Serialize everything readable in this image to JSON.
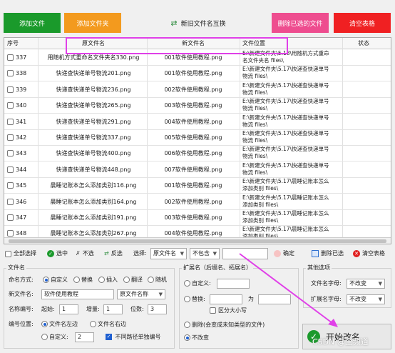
{
  "toolbar": {
    "add_files": "添加文件",
    "add_folder": "添加文件夹",
    "swap_names": "新旧文件名互换",
    "delete_checked": "删除已选的文件",
    "clear_table": "清空表格"
  },
  "table": {
    "headers": [
      "序号",
      "原文件名",
      "新文件名",
      "文件位置",
      "状态"
    ],
    "rows": [
      {
        "no": "337",
        "orig": "用随机方式重命名文件夹名330.png",
        "new": "001软件使用教程.png",
        "loc1": "E:\\新建文件夹\\5.18\\用随机方式重命",
        "loc2": "名文件夹名 files\\"
      },
      {
        "no": "338",
        "orig": "快递查快递单号物流201.png",
        "new": "001软件使用教程.png",
        "loc1": "E:\\新建文件夹\\5.17\\快递查快递单号",
        "loc2": "物流 files\\"
      },
      {
        "no": "339",
        "orig": "快递查快递单号物流236.png",
        "new": "002软件使用教程.png",
        "loc1": "E:\\新建文件夹\\5.17\\快递查快递单号",
        "loc2": "物流 files\\"
      },
      {
        "no": "340",
        "orig": "快递查快递单号物流265.png",
        "new": "003软件使用教程.png",
        "loc1": "E:\\新建文件夹\\5.17\\快递查快递单号",
        "loc2": "物流 files\\"
      },
      {
        "no": "341",
        "orig": "快递查快递单号物流291.png",
        "new": "004软件使用教程.png",
        "loc1": "E:\\新建文件夹\\5.17\\快递查快递单号",
        "loc2": "物流 files\\"
      },
      {
        "no": "342",
        "orig": "快递查快递单号物流337.png",
        "new": "005软件使用教程.png",
        "loc1": "E:\\新建文件夹\\5.17\\快递查快递单号",
        "loc2": "物流 files\\"
      },
      {
        "no": "343",
        "orig": "快递查快递单号物流400.png",
        "new": "006软件使用教程.png",
        "loc1": "E:\\新建文件夹\\5.17\\快递查快递单号",
        "loc2": "物流 files\\"
      },
      {
        "no": "344",
        "orig": "快递查快递单号物流448.png",
        "new": "007软件使用教程.png",
        "loc1": "E:\\新建文件夹\\5.17\\快递查快递单号",
        "loc2": "物流 files\\"
      },
      {
        "no": "345",
        "orig": "晨睡记账本怎么添加类别116.png",
        "new": "001软件使用教程.png",
        "loc1": "E:\\新建文件夹\\5.17\\晨睡记账本怎么",
        "loc2": "添加类别 files\\"
      },
      {
        "no": "346",
        "orig": "晨睡记账本怎么添加类别164.png",
        "new": "002软件使用教程.png",
        "loc1": "E:\\新建文件夹\\5.17\\晨睡记账本怎么",
        "loc2": "添加类别 files\\"
      },
      {
        "no": "347",
        "orig": "晨睡记账本怎么添加类别191.png",
        "new": "003软件使用教程.png",
        "loc1": "E:\\新建文件夹\\5.17\\晨睡记账本怎么",
        "loc2": "添加类别 files\\"
      },
      {
        "no": "348",
        "orig": "晨睡记账本怎么添加类别267.png",
        "new": "004软件使用教程.png",
        "loc1": "E:\\新建文件夹\\5.17\\晨睡记账本怎么",
        "loc2": "添加类别 files\\"
      }
    ]
  },
  "filter": {
    "select_all": "全部选择",
    "select": "选中",
    "deselect": "不选",
    "invert": "反选",
    "choose": "选择:",
    "field_value": "原文件名",
    "mode_value": "不包含",
    "text_value": "",
    "confirm": "确定",
    "delete_selected": "删除已选",
    "clear_table": "清空表格"
  },
  "filename": {
    "title": "文件名",
    "naming_mode_label": "命名方式:",
    "modes": [
      "自定义",
      "替换",
      "插入",
      "翻译",
      "随机"
    ],
    "new_name_label": "新文件名:",
    "new_name_value": "软件使用教程",
    "orig_name_option": "原文件名称",
    "numbering_label": "名称编号:",
    "start_label": "起始:",
    "start_value": "1",
    "increment_label": "增量:",
    "increment_value": "1",
    "digits_label": "位数:",
    "digits_value": "3",
    "position_label": "编号位置:",
    "left": "文件名左边",
    "right": "文件名右边",
    "custom": "自定义:",
    "custom_value": "2",
    "separate_numbering": "不同路径单独编号"
  },
  "extension": {
    "title": "扩展名（后缀名、拓展名）",
    "custom": "自定义:",
    "replace": "替换:",
    "with": "为",
    "case_sensitive": "区分大小写",
    "delete": "删除(会变成未知类型的文件)",
    "unchanged": "不改变"
  },
  "other": {
    "title": "其他选项",
    "filename_case_label": "文件名字母:",
    "filename_case_value": "不改变",
    "ext_case_label": "扩展名字母:",
    "ext_case_value": "不改变"
  },
  "start_button": "开始改名",
  "watermark": "CSDN @全频道",
  "colors": {
    "green": "#1a9a2b",
    "orange": "#f39a1e",
    "pink": "#ee4d8f",
    "red": "#f02022",
    "highlight": "#e040e8"
  }
}
